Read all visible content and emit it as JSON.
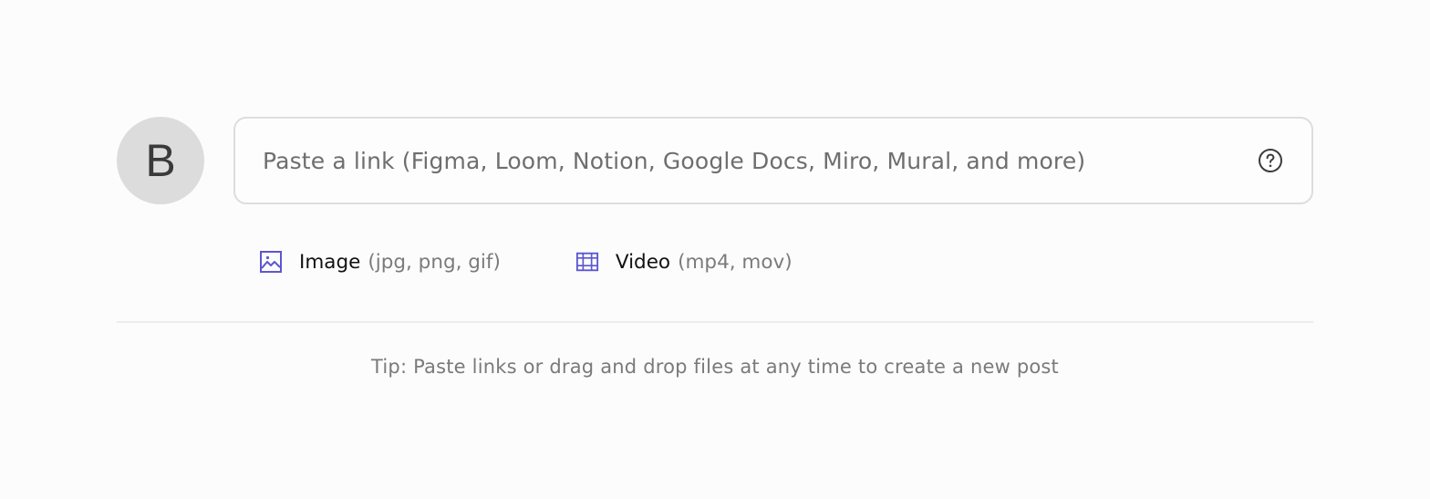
{
  "avatar": {
    "initial": "B"
  },
  "link_input": {
    "value": "",
    "placeholder": "Paste a link (Figma, Loom, Notion, Google Docs, Miro, Mural, and more)"
  },
  "help_icon": "question-circle-icon",
  "attachments": [
    {
      "icon": "image-icon",
      "label": "Image",
      "hint": "(jpg, png, gif)"
    },
    {
      "icon": "film-icon",
      "label": "Video",
      "hint": "(mp4, mov)"
    }
  ],
  "tip": "Tip: Paste links or drag and drop files at any time to create a new post",
  "colors": {
    "accent": "#5b57d1",
    "background": "#fdfcfc",
    "avatar_bg": "#dcdcdc",
    "border": "#dddddd"
  }
}
